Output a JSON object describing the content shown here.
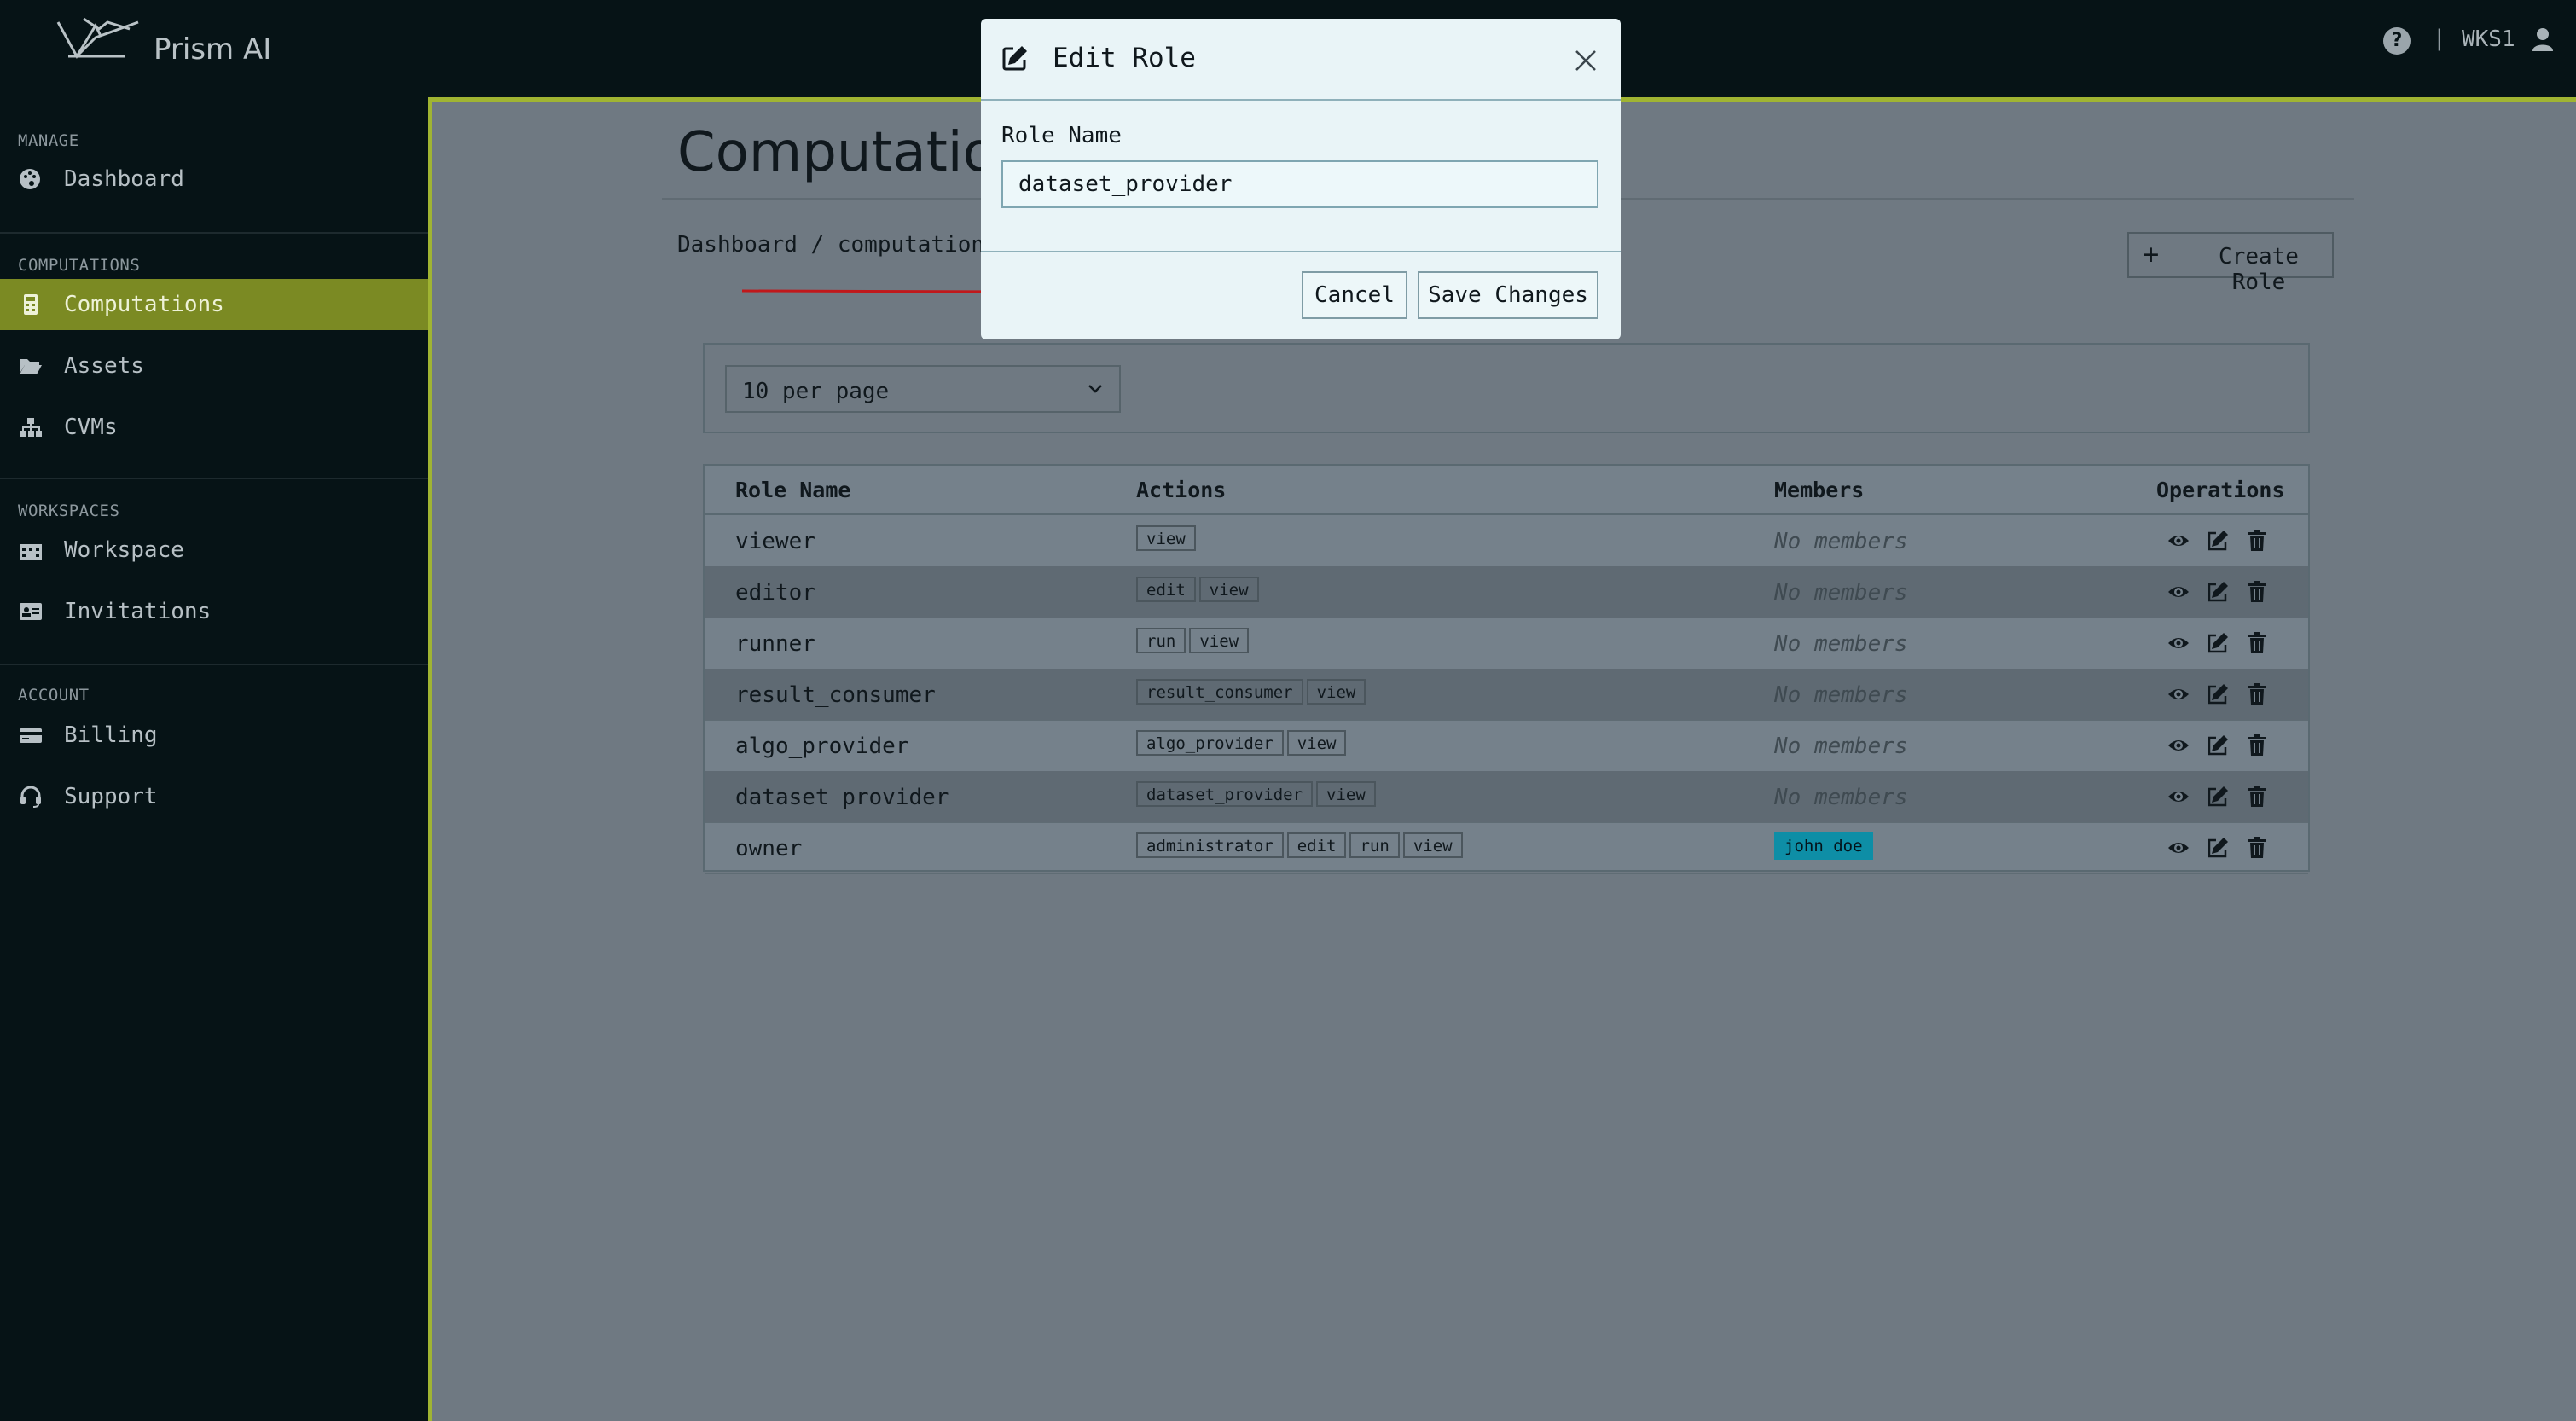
{
  "app": {
    "name": "Prism AI",
    "workspace": "WKS1"
  },
  "sidebar": {
    "sections": [
      {
        "title": "MANAGE",
        "items": [
          {
            "label": "Dashboard",
            "icon": "palette-icon"
          }
        ]
      },
      {
        "title": "COMPUTATIONS",
        "items": [
          {
            "label": "Computations",
            "icon": "calculator-icon",
            "active": true
          },
          {
            "label": "Assets",
            "icon": "folder-open-icon"
          },
          {
            "label": "CVMs",
            "icon": "sitemap-icon"
          }
        ]
      },
      {
        "title": "WORKSPACES",
        "items": [
          {
            "label": "Workspace",
            "icon": "building-icon"
          },
          {
            "label": "Invitations",
            "icon": "id-card-icon"
          }
        ]
      },
      {
        "title": "ACCOUNT",
        "items": [
          {
            "label": "Billing",
            "icon": "credit-card-icon"
          },
          {
            "label": "Support",
            "icon": "headset-icon"
          }
        ]
      }
    ]
  },
  "page": {
    "title": "Computations",
    "breadcrumb": {
      "root": "Dashboard",
      "sep": "/",
      "current": "computations"
    },
    "create_button": "Create Role",
    "per_page": "10 per page"
  },
  "table": {
    "headers": {
      "name": "Role Name",
      "actions": "Actions",
      "members": "Members",
      "operations": "Operations"
    },
    "rows": [
      {
        "name": "viewer",
        "actions": [
          "view"
        ],
        "members": "No members"
      },
      {
        "name": "editor",
        "actions": [
          "edit",
          "view"
        ],
        "members": "No members"
      },
      {
        "name": "runner",
        "actions": [
          "run",
          "view"
        ],
        "members": "No members"
      },
      {
        "name": "result_consumer",
        "actions": [
          "result_consumer",
          "view"
        ],
        "members": "No members"
      },
      {
        "name": "algo_provider",
        "actions": [
          "algo_provider",
          "view"
        ],
        "members": "No members"
      },
      {
        "name": "dataset_provider",
        "actions": [
          "dataset_provider",
          "view"
        ],
        "members": "No members"
      },
      {
        "name": "owner",
        "actions": [
          "administrator",
          "edit",
          "run",
          "view"
        ],
        "member_badge": "john doe"
      }
    ]
  },
  "modal": {
    "title": "Edit Role",
    "field_label": "Role Name",
    "field_value": "dataset_provider",
    "cancel": "Cancel",
    "save": "Save Changes"
  },
  "colors": {
    "sidebar_bg": "#061316",
    "active_item": "#7b8a23",
    "accent_border": "#a0b432",
    "member_badge": "#0e8ea6",
    "annotation_arrow": "#c0181b"
  }
}
